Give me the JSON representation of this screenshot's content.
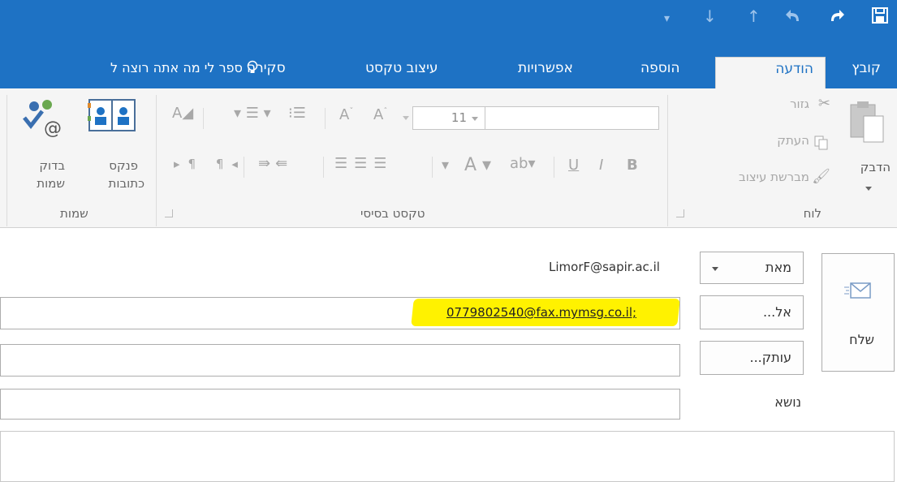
{
  "quick_access": {
    "save_icon": "save-icon",
    "redo_icon": "redo-icon",
    "undo_icon": "undo-icon",
    "up_icon": "up-arrow-icon",
    "down_icon": "down-arrow-icon",
    "customize_icon": "customize-qat-icon"
  },
  "tabs": {
    "file": "קובץ",
    "message": "הודעה",
    "insert": "הוספה",
    "options": "אפשרויות",
    "format_text": "עיצוב טקסט",
    "review": "סקירה",
    "tell_me": "ספר לי מה אתה רוצה ל"
  },
  "clipboard": {
    "paste": "הדבק",
    "cut": "גזור",
    "copy": "העתק",
    "format_painter": "מברשת עיצוב",
    "group_label": "לוח"
  },
  "basic_text": {
    "font_size": "11",
    "bold": "B",
    "italic": "I",
    "underline": "U",
    "group_label": "טקסט בסיסי"
  },
  "names": {
    "address_book_line1": "פנקס",
    "address_book_line2": "כתובות",
    "check_names_line1": "בדוק",
    "check_names_line2": "שמות",
    "group_label": "שמות"
  },
  "compose": {
    "send": "שלח",
    "from_button": "מאת",
    "from_value": "LimorF@sapir.ac.il",
    "to_button": "אל...",
    "to_value": "0779802540@fax.mymsg.co.il;",
    "cc_button": "עותק...",
    "subject_label": "נושא"
  },
  "colors": {
    "accent": "#1e72c4",
    "highlight": "#fff200"
  }
}
